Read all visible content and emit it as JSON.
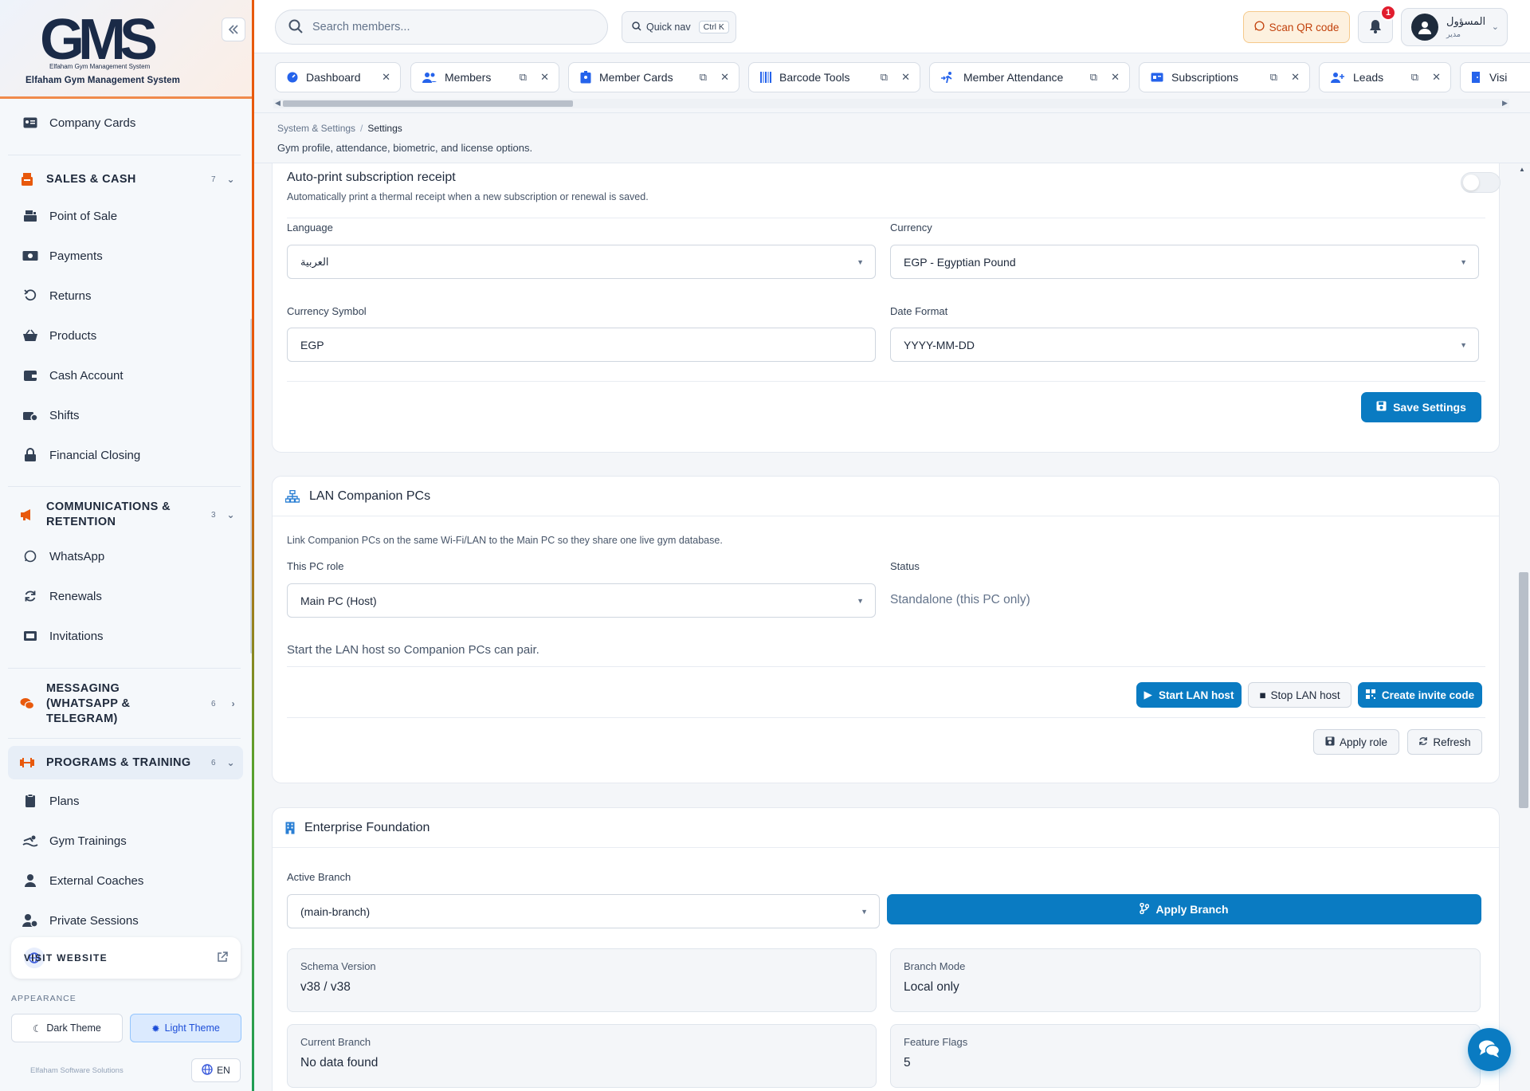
{
  "brand": {
    "logo_text": "GMS",
    "logo_tagline": "Elfaham Gym Management System",
    "subtitle": "Elfaham Gym Management System",
    "footer": "Elfaham Software Solutions"
  },
  "sidebar": {
    "items": [
      {
        "label": "Company Cards",
        "icon": "id-card-icon"
      },
      {
        "label": "Point of Sale",
        "icon": "cash-register-icon"
      },
      {
        "label": "Payments",
        "icon": "money-icon"
      },
      {
        "label": "Returns",
        "icon": "undo-icon"
      },
      {
        "label": "Products",
        "icon": "basket-icon"
      },
      {
        "label": "Cash Account",
        "icon": "wallet-icon"
      },
      {
        "label": "Shifts",
        "icon": "shift-icon"
      },
      {
        "label": "Financial Closing",
        "icon": "lock-icon"
      },
      {
        "label": "WhatsApp",
        "icon": "whatsapp-icon"
      },
      {
        "label": "Renewals",
        "icon": "refresh-icon"
      },
      {
        "label": "Invitations",
        "icon": "ticket-icon"
      },
      {
        "label": "Plans",
        "icon": "clipboard-icon"
      },
      {
        "label": "Gym Trainings",
        "icon": "swimmer-icon"
      },
      {
        "label": "External Coaches",
        "icon": "person-icon"
      },
      {
        "label": "Private Sessions",
        "icon": "person-clock-icon"
      }
    ],
    "groups": [
      {
        "label": "SALES & CASH",
        "count": "7",
        "icon": "cash-icon"
      },
      {
        "label_line1": "COMMUNICATIONS &",
        "label_line2": "RETENTION",
        "count": "3",
        "icon": "megaphone-icon"
      },
      {
        "label_line1": "MESSAGING",
        "label_line2": "(WHATSAPP &",
        "label_line3": "TELEGRAM)",
        "count": "6",
        "icon": "chat-icon"
      },
      {
        "label": "PROGRAMS & TRAINING",
        "count": "6",
        "icon": "dumbbell-icon"
      }
    ],
    "visit_website": "VISIT WEBSITE",
    "appearance_label": "APPEARANCE",
    "dark_theme": "Dark Theme",
    "light_theme": "Light Theme",
    "language": "EN"
  },
  "topbar": {
    "search_placeholder": "Search members...",
    "quick_nav": "Quick nav",
    "quick_nav_kbd": "Ctrl K",
    "scan_qr": "Scan QR code",
    "notification_count": "1",
    "user_name": "المسؤول",
    "user_role": "مدير"
  },
  "tabs": [
    {
      "label": "Dashboard"
    },
    {
      "label": "Members"
    },
    {
      "label": "Member Cards"
    },
    {
      "label": "Barcode Tools"
    },
    {
      "label": "Member Attendance"
    },
    {
      "label": "Subscriptions"
    },
    {
      "label": "Leads"
    },
    {
      "label": "Visi"
    }
  ],
  "breadcrumb": {
    "parent": "System & Settings",
    "current": "Settings"
  },
  "page_description": "Gym profile, attendance, biometric, and license options.",
  "general": {
    "auto_print_title": "Auto-print subscription receipt",
    "auto_print_desc": "Automatically print a thermal receipt when a new subscription or renewal is saved.",
    "language_label": "Language",
    "language_value": "العربية",
    "currency_label": "Currency",
    "currency_value": "EGP - Egyptian Pound",
    "currency_symbol_label": "Currency Symbol",
    "currency_symbol_value": "EGP",
    "date_format_label": "Date Format",
    "date_format_value": "YYYY-MM-DD",
    "save_button": "Save Settings"
  },
  "lan": {
    "title": "LAN Companion PCs",
    "description": "Link Companion PCs on the same Wi-Fi/LAN to the Main PC so they share one live gym database.",
    "role_label": "This PC role",
    "role_value": "Main PC (Host)",
    "status_label": "Status",
    "status_value": "Standalone (this PC only)",
    "hint": "Start the LAN host so Companion PCs can pair.",
    "start_button": "Start LAN host",
    "stop_button": "Stop LAN host",
    "invite_button": "Create invite code",
    "apply_role_button": "Apply role",
    "refresh_button": "Refresh"
  },
  "enterprise": {
    "title": "Enterprise Foundation",
    "branch_label": "Active Branch",
    "branch_value": "(main-branch)",
    "apply_branch_button": "Apply Branch",
    "schema_label": "Schema Version",
    "schema_value": "v38 / v38",
    "mode_label": "Branch Mode",
    "mode_value": "Local only",
    "current_branch_label": "Current Branch",
    "current_branch_value": "No data found",
    "flags_label": "Feature Flags",
    "flags_value": "5"
  },
  "colors": {
    "primary": "#0a7bc2",
    "accent_orange": "#e8590c",
    "badge_red": "#e11d2e"
  }
}
